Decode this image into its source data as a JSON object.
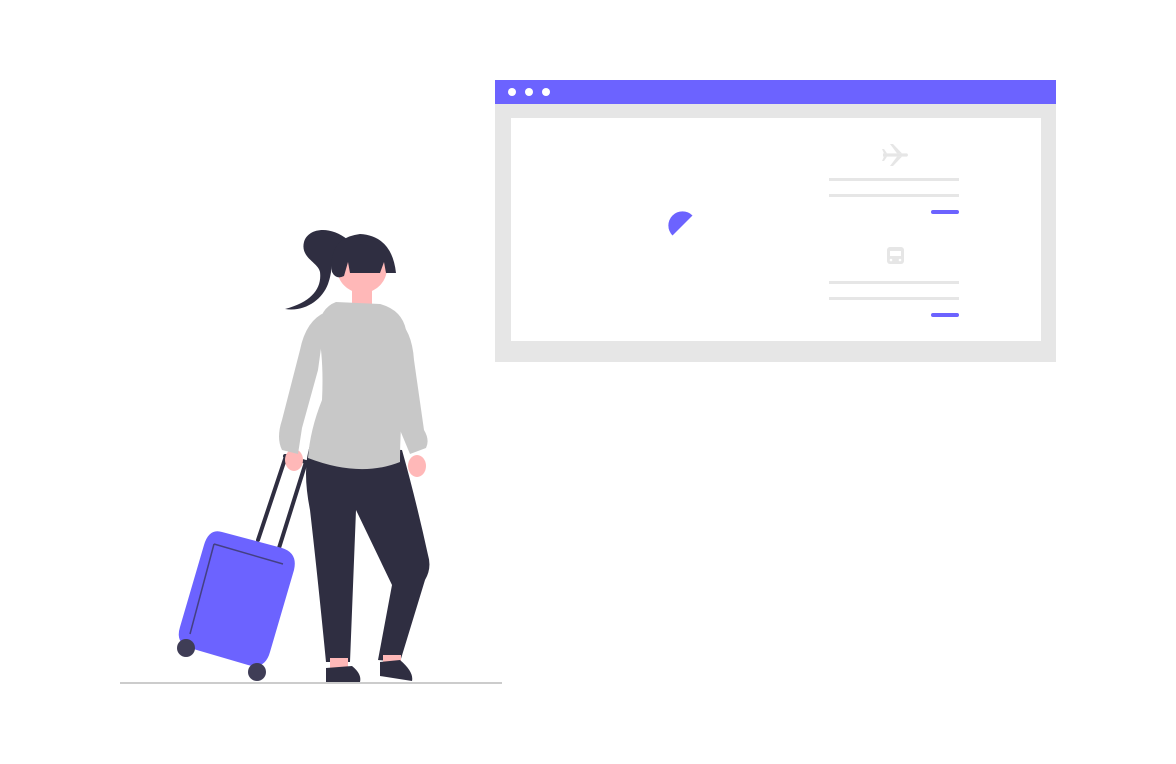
{
  "colors": {
    "accent": "#6c63ff",
    "frame": "#e6e6e6",
    "window_bg": "#ffffff",
    "line": "#e6e6e6",
    "dark": "#2f2e41",
    "skin": "#ffb8b8",
    "sweater": "#c8c8c8",
    "hair": "#2f2e41",
    "floor": "#cccccc"
  },
  "browser": {
    "controls": [
      "dot",
      "dot",
      "dot"
    ],
    "spinner_icon": "loading-spinner-icon",
    "cards": [
      {
        "icon": "airplane-icon"
      },
      {
        "icon": "bus-icon"
      }
    ]
  }
}
